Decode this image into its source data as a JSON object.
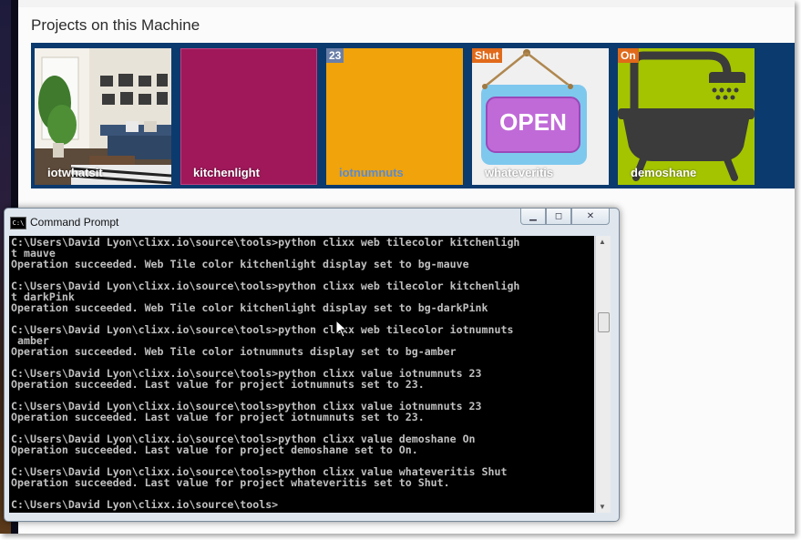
{
  "section": {
    "title": "Projects on this Machine"
  },
  "tiles": [
    {
      "label": "iotwhatsit",
      "badge": "",
      "color": "#e9e4db"
    },
    {
      "label": "kitchenlight",
      "badge": "",
      "color": "#a0185a"
    },
    {
      "label": "iotnumnuts",
      "badge": "23",
      "color": "#f0a30a"
    },
    {
      "label": "whateveritis",
      "badge": "Shut",
      "color": "#eeeeee"
    },
    {
      "label": "demoshane",
      "badge": "On",
      "color": "#a4c400"
    }
  ],
  "open_sign": {
    "text": "OPEN"
  },
  "cmd": {
    "title": "Command Prompt",
    "icon_text": "C:\\",
    "controls": {
      "minimize": "▁",
      "restore": "◻",
      "close": "✕"
    },
    "lines": [
      "C:\\Users\\David Lyon\\clixx.io\\source\\tools>python clixx web tilecolor kitchenligh",
      "t mauve",
      "Operation succeeded. Web Tile color kitchenlight display set to bg-mauve",
      "",
      "C:\\Users\\David Lyon\\clixx.io\\source\\tools>python clixx web tilecolor kitchenligh",
      "t darkPink",
      "Operation succeeded. Web Tile color kitchenlight display set to bg-darkPink",
      "",
      "C:\\Users\\David Lyon\\clixx.io\\source\\tools>python clixx web tilecolor iotnumnuts",
      " amber",
      "Operation succeeded. Web Tile color iotnumnuts display set to bg-amber",
      "",
      "C:\\Users\\David Lyon\\clixx.io\\source\\tools>python clixx value iotnumnuts 23",
      "Operation succeeded. Last value for project iotnumnuts set to 23.",
      "",
      "C:\\Users\\David Lyon\\clixx.io\\source\\tools>python clixx value iotnumnuts 23",
      "Operation succeeded. Last value for project iotnumnuts set to 23.",
      "",
      "C:\\Users\\David Lyon\\clixx.io\\source\\tools>python clixx value demoshane On",
      "Operation succeeded. Last value for project demoshane set to On.",
      "",
      "C:\\Users\\David Lyon\\clixx.io\\source\\tools>python clixx value whateveritis Shut",
      "Operation succeeded. Last value for project whateveritis set to Shut.",
      "",
      "C:\\Users\\David Lyon\\clixx.io\\source\\tools>"
    ]
  }
}
